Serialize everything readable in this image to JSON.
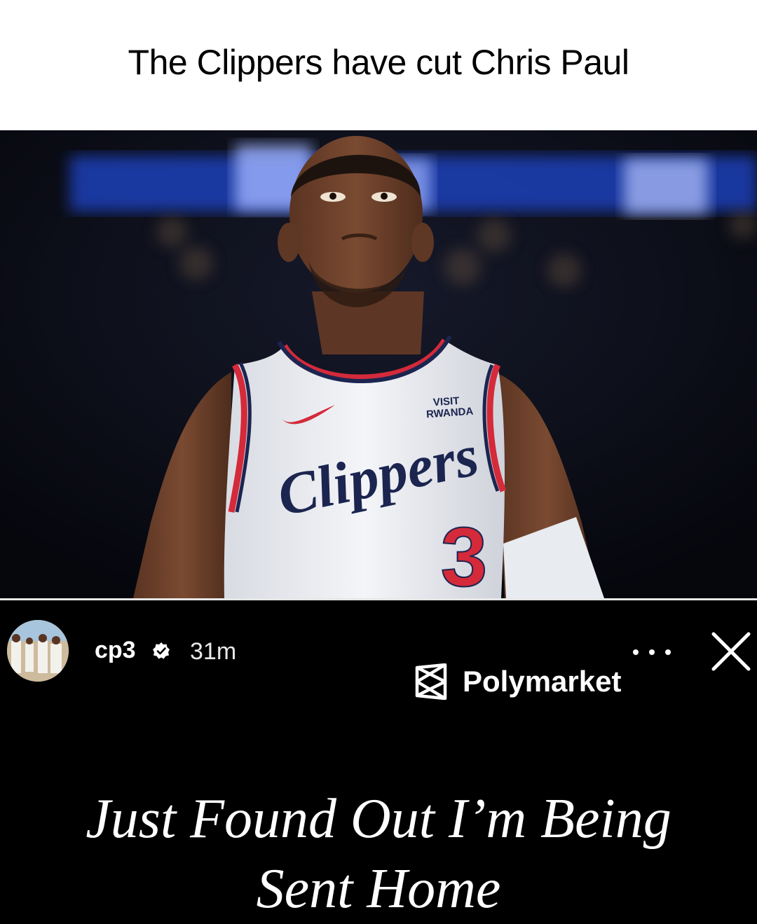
{
  "caption": {
    "text": "The Clippers have cut Chris Paul"
  },
  "photo": {
    "jersey_sponsor_line1": "VISIT",
    "jersey_sponsor_line2": "RWANDA",
    "jersey_team": "Clippers",
    "jersey_number": "3"
  },
  "story": {
    "username": "cp3",
    "timestamp": "31m",
    "sponsor": "Polymarket",
    "headline_line1": "Just Found Out I’m Being",
    "headline_line2": "Sent Home"
  },
  "icons": {
    "verified": "verified-badge-icon",
    "more": "more-options-icon",
    "close": "close-icon",
    "sponsor_logo": "polymarket-logo-icon"
  },
  "colors": {
    "jersey_red": "#d42a3a",
    "jersey_navy": "#1b2550",
    "background": "#000000"
  }
}
